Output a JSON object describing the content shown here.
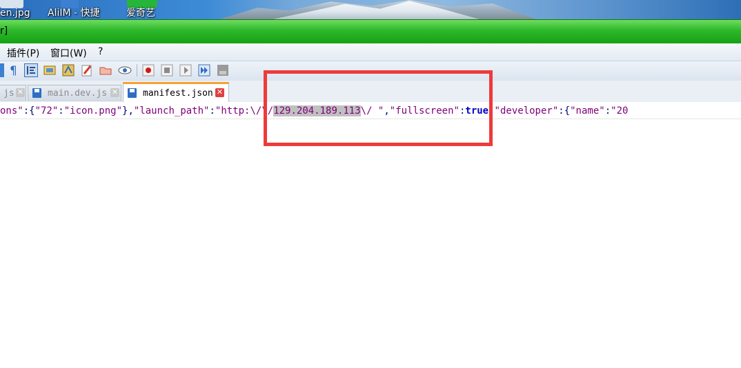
{
  "desktop": {
    "icons": [
      {
        "label": "en.jpg",
        "name": "image-file-icon"
      },
      {
        "label": "AliIM - 快捷",
        "name": "aliim-shortcut-icon"
      },
      {
        "label": "爱奇艺",
        "name": "iqiyi-icon"
      }
    ]
  },
  "window": {
    "title_fragment": "r]"
  },
  "menu": {
    "items": [
      "插件(P)",
      "窗口(W)",
      "?"
    ]
  },
  "toolbar": {
    "icons": [
      "paragraph-icon",
      "indent-guide-icon",
      "document-map-icon",
      "function-list-icon",
      "pen-icon",
      "folder-icon",
      "eye-icon",
      "record-macro-icon",
      "stop-macro-icon",
      "play-macro-icon",
      "run-macro-multiple-icon",
      "save-macro-icon"
    ]
  },
  "tabs": [
    {
      "label": "js",
      "active": false
    },
    {
      "label": "main.dev.js",
      "active": false
    },
    {
      "label": "manifest.json",
      "active": true
    }
  ],
  "editor": {
    "tokens": [
      {
        "text": "ons\"",
        "cls": "c-str"
      },
      {
        "text": ":{",
        "cls": "c-op"
      },
      {
        "text": "\"72\"",
        "cls": "c-str"
      },
      {
        "text": ":",
        "cls": "c-op"
      },
      {
        "text": "\"icon.png\"",
        "cls": "c-str"
      },
      {
        "text": "},",
        "cls": "c-op"
      },
      {
        "text": "\"launch_path\"",
        "cls": "c-str"
      },
      {
        "text": ":",
        "cls": "c-op"
      },
      {
        "text": "\"http:\\/\\/",
        "cls": "c-url"
      },
      {
        "text": "129.204.189.113",
        "cls": "c-sel"
      },
      {
        "text": "\\/ \"",
        "cls": "c-url"
      },
      {
        "text": ",",
        "cls": "c-op"
      },
      {
        "text": "\"fullscreen\"",
        "cls": "c-str"
      },
      {
        "text": ":",
        "cls": "c-op"
      },
      {
        "text": "true",
        "cls": "c-kw"
      },
      {
        "text": ",",
        "cls": "c-op"
      },
      {
        "text": "\"developer\"",
        "cls": "c-str"
      },
      {
        "text": ":{",
        "cls": "c-op"
      },
      {
        "text": "\"name\"",
        "cls": "c-str"
      },
      {
        "text": ":",
        "cls": "c-op"
      },
      {
        "text": "\"20",
        "cls": "c-str"
      }
    ]
  },
  "colors": {
    "annotation": "#ee3a3a",
    "titlebar": "#2db82a",
    "tab_accent": "#f5a234"
  }
}
